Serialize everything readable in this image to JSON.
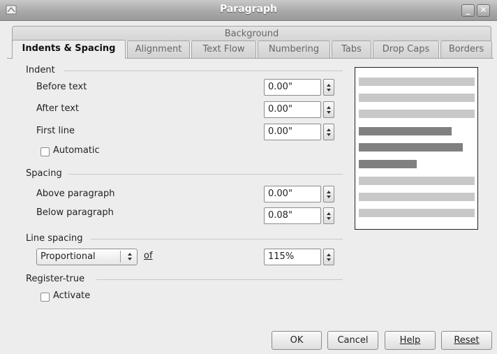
{
  "window": {
    "title": "Paragraph"
  },
  "tabs_top": [
    "Background"
  ],
  "tabs": [
    {
      "label": "Indents & Spacing",
      "active": true
    },
    {
      "label": "Alignment"
    },
    {
      "label": "Text Flow"
    },
    {
      "label": "Numbering"
    },
    {
      "label": "Tabs"
    },
    {
      "label": "Drop Caps"
    },
    {
      "label": "Borders"
    }
  ],
  "indent": {
    "section": "Indent",
    "before_text_label": "Before text",
    "before_text_value": "0.00\"",
    "after_text_label": "After text",
    "after_text_value": "0.00\"",
    "first_line_label": "First line",
    "first_line_value": "0.00\"",
    "automatic_label": "Automatic"
  },
  "spacing": {
    "section": "Spacing",
    "above_label": "Above paragraph",
    "above_value": "0.00\"",
    "below_label": "Below paragraph",
    "below_value": "0.08\""
  },
  "line_spacing": {
    "section": "Line spacing",
    "mode": "Proportional",
    "of_label": "of",
    "value": "115%"
  },
  "register_true": {
    "section": "Register-true",
    "activate_label": "Activate"
  },
  "buttons": {
    "ok": "OK",
    "cancel": "Cancel",
    "help": "Help",
    "reset": "Reset"
  },
  "colors": {
    "preview_light": "#c8c8c8",
    "preview_dark": "#808080"
  },
  "icons": [
    "app-icon",
    "minimize-icon",
    "close-icon"
  ]
}
